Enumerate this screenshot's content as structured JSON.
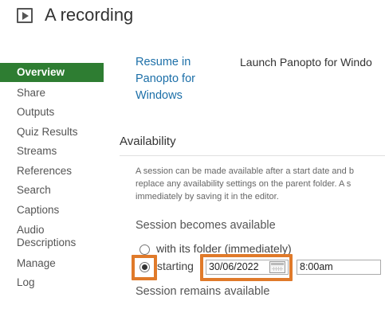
{
  "header": {
    "title": "A recording",
    "icon": "play-icon"
  },
  "sidebar": {
    "items": [
      {
        "label": "Overview",
        "active": true
      },
      {
        "label": "Share"
      },
      {
        "label": "Outputs"
      },
      {
        "label": "Quiz Results"
      },
      {
        "label": "Streams"
      },
      {
        "label": "References"
      },
      {
        "label": "Search"
      },
      {
        "label": "Captions"
      },
      {
        "label": "Audio Descriptions"
      },
      {
        "label": "Manage"
      },
      {
        "label": "Log"
      }
    ],
    "active_color": "#2e7d32"
  },
  "main": {
    "resume_link": "Resume in Panopto for Windows",
    "launch_text": "Launch Panopto for Windo",
    "availability": {
      "heading": "Availability",
      "description": [
        "A session can be made available after a start date and b",
        "replace any availability settings on the parent folder. A s",
        "immediately by saving it in the editor."
      ],
      "becomes_available_heading": "Session becomes available",
      "option_with_folder": "with its folder (immediately)",
      "option_starting": "starting",
      "selected_option": "starting",
      "start_date": "30/06/2022",
      "start_time": "8:00am",
      "remains_available_heading": "Session remains available"
    }
  },
  "colors": {
    "link": "#1c6fa8",
    "highlight": "#e07a2a"
  }
}
